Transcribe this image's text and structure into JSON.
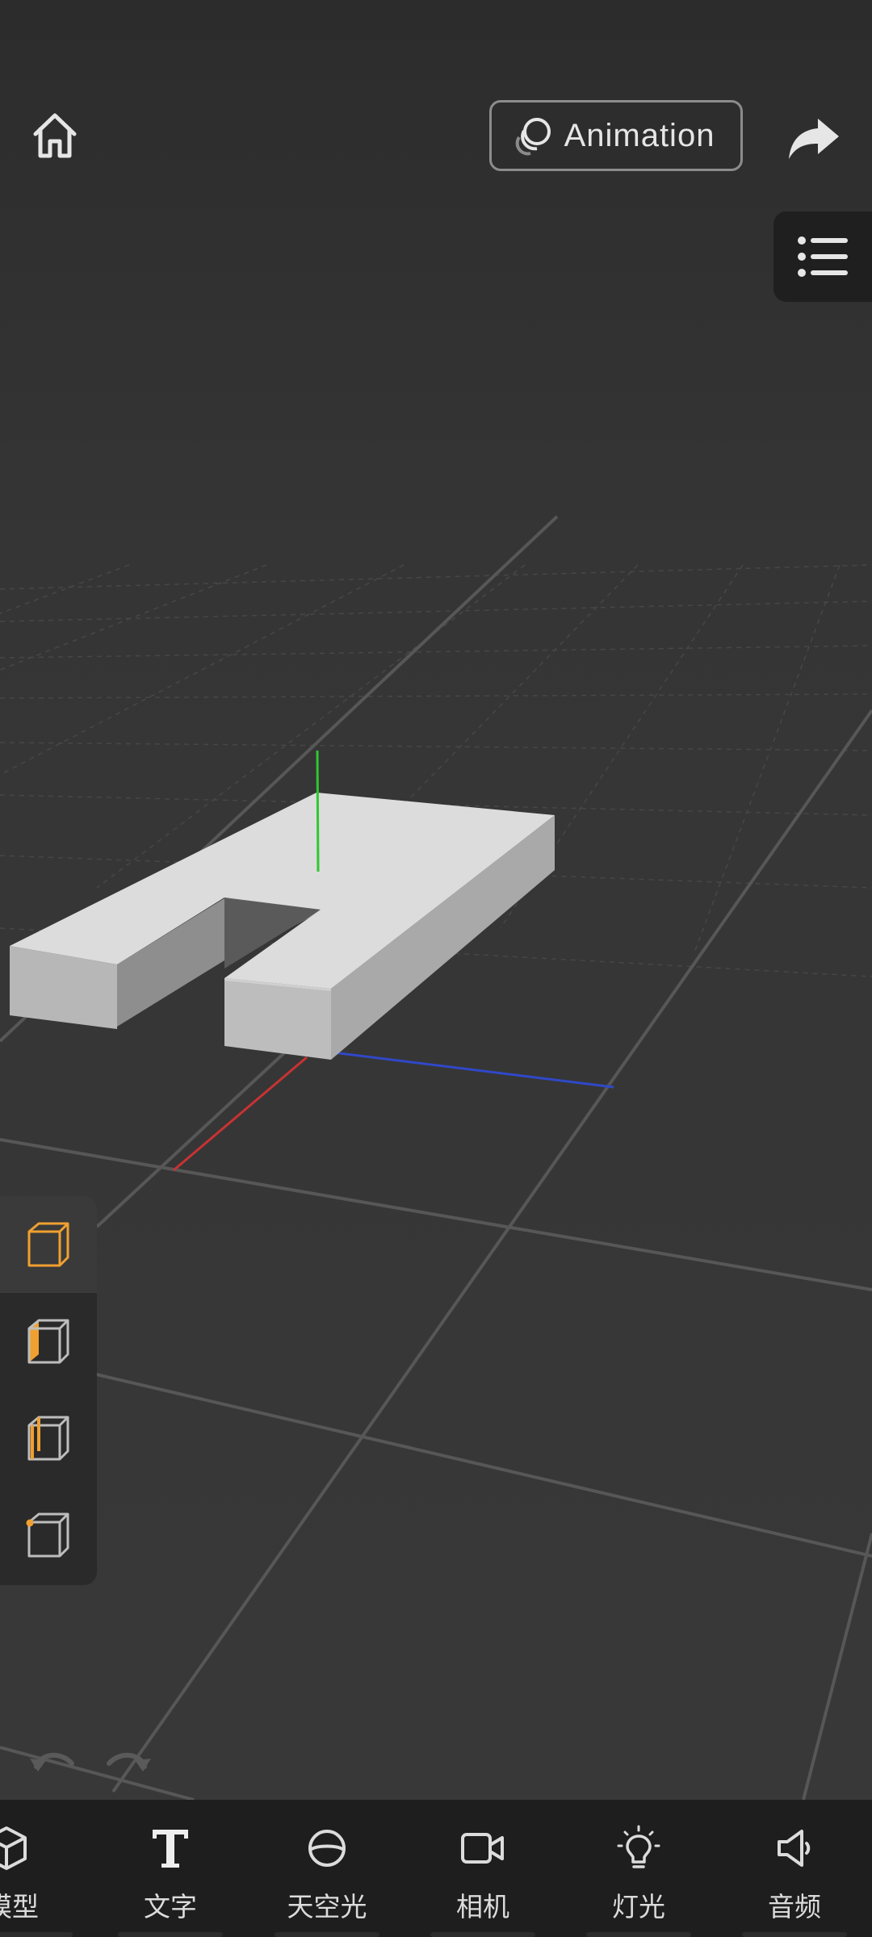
{
  "header": {
    "home_icon": "home-icon",
    "animation_label": "Animation",
    "animation_icon": "animation-rings-icon",
    "share_icon": "share-arrow-icon",
    "menu_icon": "list-menu-icon"
  },
  "selection_modes": [
    {
      "name": "object",
      "icon": "cube-object-icon",
      "active": true
    },
    {
      "name": "face",
      "icon": "cube-face-icon",
      "active": false
    },
    {
      "name": "edge",
      "icon": "cube-edge-icon",
      "active": false
    },
    {
      "name": "vertex",
      "icon": "cube-vertex-icon",
      "active": false
    }
  ],
  "history": {
    "undo_icon": "undo-icon",
    "redo_icon": "redo-icon"
  },
  "bottom_nav": {
    "items": [
      {
        "label": "模型",
        "icon": "cube-icon"
      },
      {
        "label": "文字",
        "icon": "text-T-icon"
      },
      {
        "label": "天空光",
        "icon": "sky-sphere-icon"
      },
      {
        "label": "相机",
        "icon": "camera-icon"
      },
      {
        "label": "灯光",
        "icon": "lightbulb-icon"
      },
      {
        "label": "音频",
        "icon": "speaker-icon"
      }
    ]
  },
  "colors": {
    "background": "#353535",
    "accent": "#f0a030",
    "axis_x": "#c83232",
    "axis_y": "#2fc82f",
    "axis_z": "#2f48c8",
    "model_top": "#dcdcdc",
    "model_side": "#b0b0b0"
  }
}
